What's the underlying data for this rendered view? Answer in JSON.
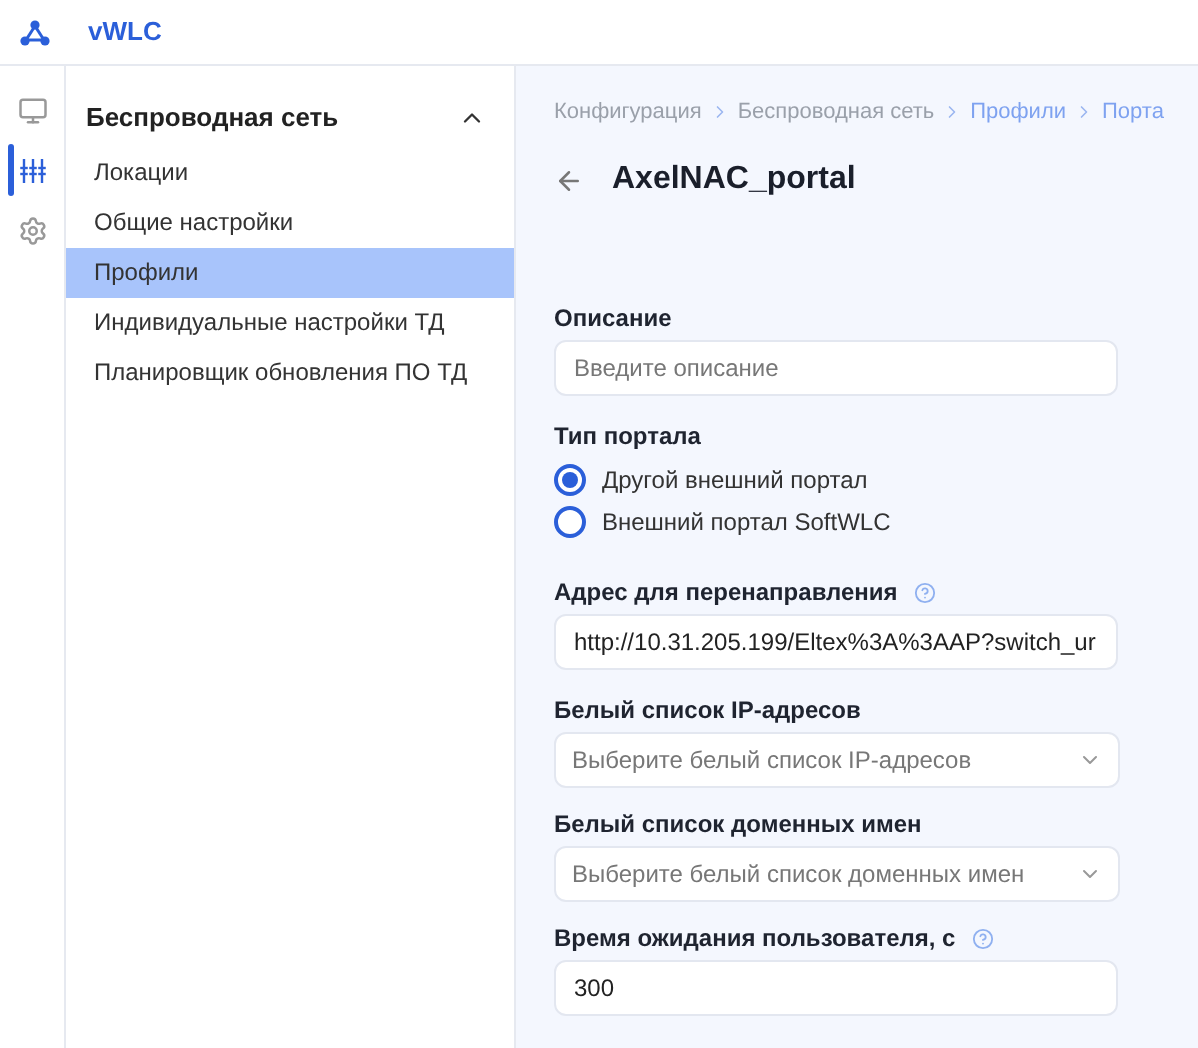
{
  "app": {
    "title": "vWLC"
  },
  "rail": [
    {
      "selected": false
    },
    {
      "selected": true
    },
    {
      "selected": false
    }
  ],
  "sidebar": {
    "title": "Беспроводная сеть",
    "expanded": true,
    "items": [
      {
        "label": "Локации",
        "selected": false
      },
      {
        "label": "Общие настройки",
        "selected": false
      },
      {
        "label": "Профили",
        "selected": true
      },
      {
        "label": "Индивидуальные настройки ТД",
        "selected": false
      },
      {
        "label": "Планировщик обновления ПО ТД",
        "selected": false
      }
    ]
  },
  "breadcrumbs": [
    {
      "label": "Конфигурация",
      "link": false
    },
    {
      "label": "Беспроводная сеть",
      "link": false
    },
    {
      "label": "Профили",
      "link": true
    },
    {
      "label": "Порта",
      "link": true
    }
  ],
  "page_title": "AxelNAC_portal",
  "fields": [
    {
      "kind": "text",
      "label": "Описание",
      "help": false,
      "placeholder": "Введите описание"
    },
    {
      "kind": "radio",
      "label": "Тип портала",
      "help": false,
      "options": [
        {
          "label": "Другой внешний портал",
          "selected": true
        },
        {
          "label": "Внешний портал SoftWLC",
          "selected": false
        }
      ]
    },
    {
      "kind": "text",
      "label": "Адрес для перенаправления",
      "help": true,
      "value": "http://10.31.205.199/Eltex%3A%3AAP?switch_ur"
    },
    {
      "kind": "select",
      "label": "Белый список IP-адресов",
      "help": false,
      "placeholder": "Выберите белый список IP-адресов"
    },
    {
      "kind": "select",
      "label": "Белый список доменных имен",
      "help": false,
      "placeholder": "Выберите белый список доменных имен"
    },
    {
      "kind": "text",
      "label": "Время ожидания пользователя, с",
      "help": true,
      "value": "300"
    }
  ]
}
